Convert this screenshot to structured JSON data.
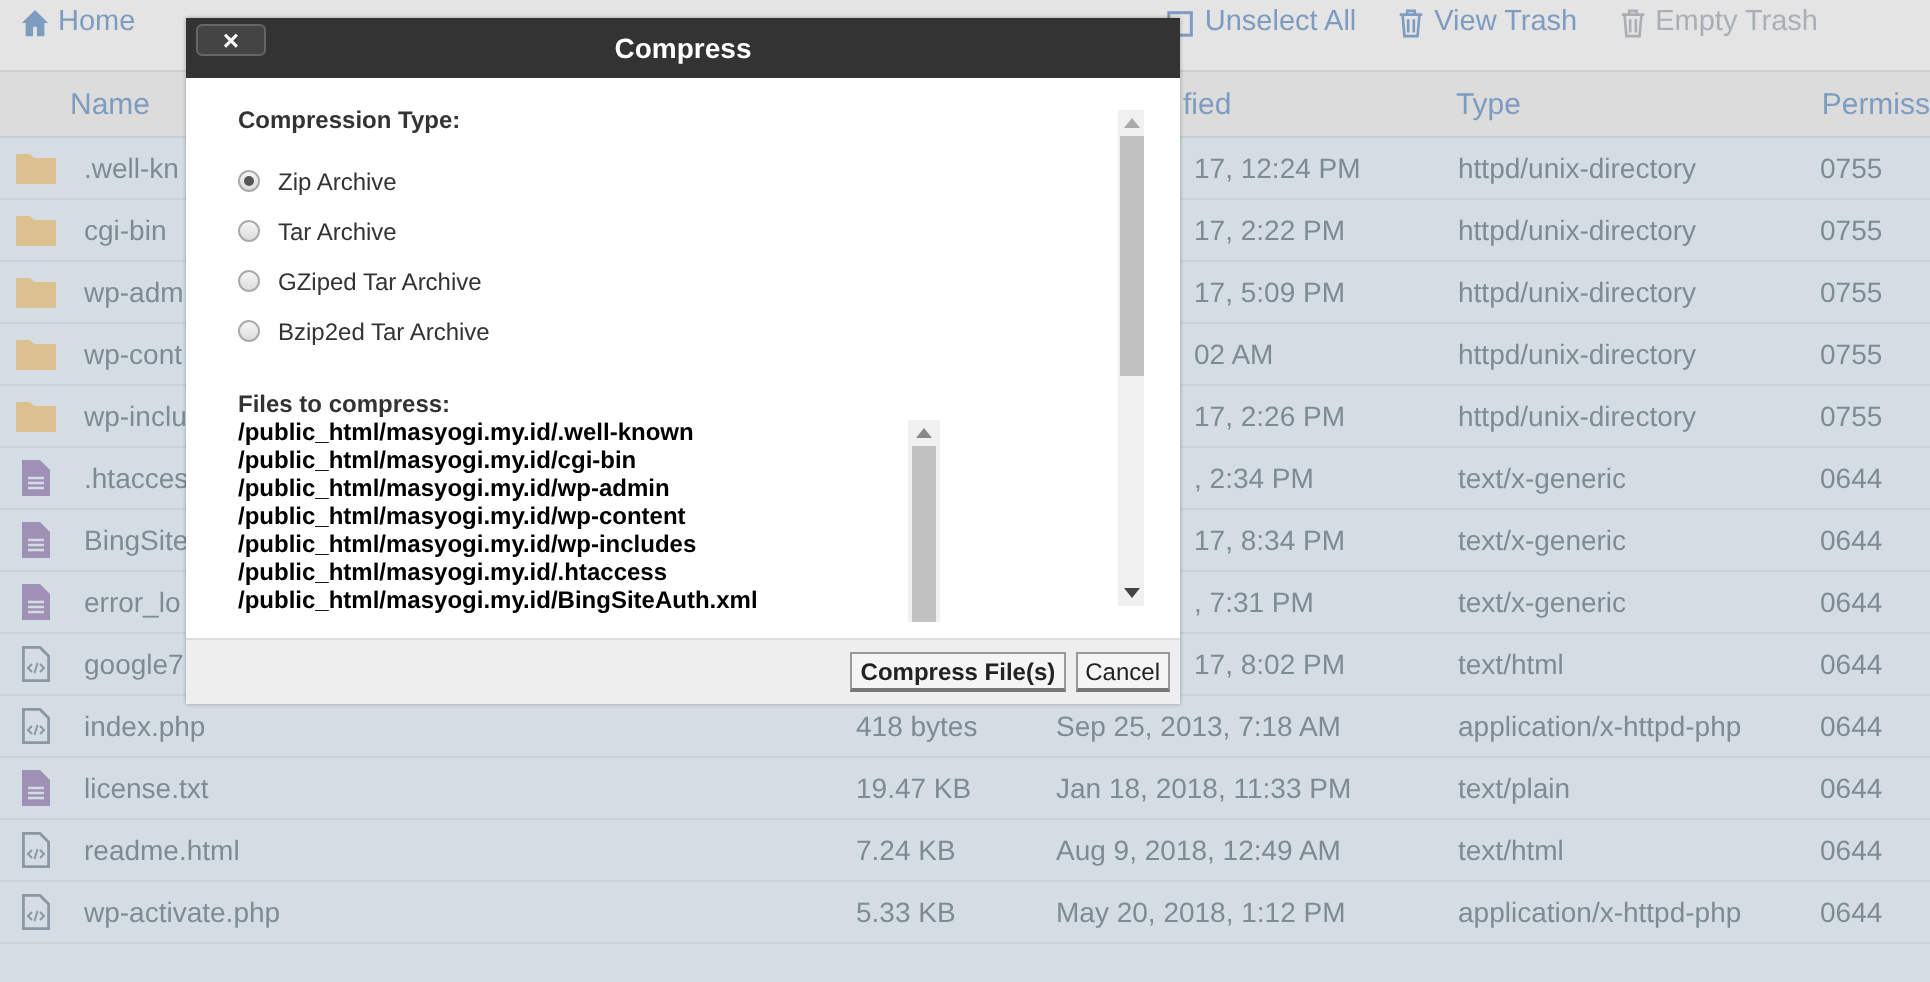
{
  "toolbar": [
    {
      "label": "Home",
      "disabled": false
    },
    {
      "label": "Unselect All",
      "disabled": false
    },
    {
      "label": "View Trash",
      "disabled": false
    },
    {
      "label": "Empty Trash",
      "disabled": true
    }
  ],
  "table": {
    "columns": [
      "Name",
      "fied",
      "Type",
      "Permiss"
    ],
    "rows": [
      {
        "kind": "folder",
        "name": ".well-kn",
        "modified": "17, 12:24 PM",
        "type": "httpd/unix-directory",
        "perms": "0755"
      },
      {
        "kind": "folder",
        "name": "cgi-bin",
        "modified": "17, 2:22 PM",
        "type": "httpd/unix-directory",
        "perms": "0755"
      },
      {
        "kind": "folder",
        "name": "wp-adm",
        "modified": "17, 5:09 PM",
        "type": "httpd/unix-directory",
        "perms": "0755"
      },
      {
        "kind": "folder",
        "name": "wp-cont",
        "modified": "02 AM",
        "type": "httpd/unix-directory",
        "perms": "0755"
      },
      {
        "kind": "folder",
        "name": "wp-inclu",
        "modified": "17, 2:26 PM",
        "type": "httpd/unix-directory",
        "perms": "0755"
      },
      {
        "kind": "text",
        "name": ".htacces",
        "modified": ", 2:34 PM",
        "type": "text/x-generic",
        "perms": "0644"
      },
      {
        "kind": "text",
        "name": "BingSite",
        "modified": "17, 8:34 PM",
        "type": "text/x-generic",
        "perms": "0644"
      },
      {
        "kind": "text",
        "name": "error_lo",
        "modified": ", 7:31 PM",
        "type": "text/x-generic",
        "perms": "0644"
      },
      {
        "kind": "code",
        "name": "google7",
        "modified": "17, 8:02 PM",
        "type": "text/html",
        "perms": "0644"
      },
      {
        "kind": "code",
        "name": "index.php",
        "size": "418 bytes",
        "modified": "Sep 25, 2013, 7:18 AM",
        "type": "application/x-httpd-php",
        "perms": "0644"
      },
      {
        "kind": "text",
        "name": "license.txt",
        "size": "19.47 KB",
        "modified": "Jan 18, 2018, 11:33 PM",
        "type": "text/plain",
        "perms": "0644"
      },
      {
        "kind": "code",
        "name": "readme.html",
        "size": "7.24 KB",
        "modified": "Aug 9, 2018, 12:49 AM",
        "type": "text/html",
        "perms": "0644"
      },
      {
        "kind": "code",
        "name": "wp-activate.php",
        "size": "5.33 KB",
        "modified": "May 20, 2018, 1:12 PM",
        "type": "application/x-httpd-php",
        "perms": "0644"
      }
    ]
  },
  "dialog": {
    "title": "Compress",
    "close": "×",
    "type_label": "Compression Type:",
    "options": [
      {
        "label": "Zip Archive",
        "selected": true
      },
      {
        "label": "Tar Archive",
        "selected": false
      },
      {
        "label": "GZiped Tar Archive",
        "selected": false
      },
      {
        "label": "Bzip2ed Tar Archive",
        "selected": false
      }
    ],
    "files_label": "Files to compress:",
    "files": [
      "/public_html/masyogi.my.id/.well-known",
      "/public_html/masyogi.my.id/cgi-bin",
      "/public_html/masyogi.my.id/wp-admin",
      "/public_html/masyogi.my.id/wp-content",
      "/public_html/masyogi.my.id/wp-includes",
      "/public_html/masyogi.my.id/.htaccess",
      "/public_html/masyogi.my.id/BingSiteAuth.xml"
    ],
    "buttons": [
      {
        "label": "Compress File(s)",
        "kind": "primary"
      },
      {
        "label": "Cancel",
        "kind": "secondary"
      }
    ]
  }
}
